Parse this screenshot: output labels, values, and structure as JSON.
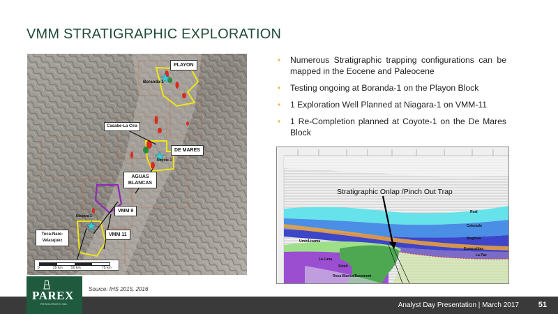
{
  "title": "VMM STRATIGRAPHIC EXPLORATION",
  "map": {
    "labels": {
      "playon": "PLAYON",
      "boranda": "Boranda-1",
      "casabe": "Casabe-La Cira",
      "de_mares": "DE MARES",
      "coyote": "Coyote-1",
      "aguas_blancas": "AGUAS BLANCAS",
      "vmm9": "VMM 9",
      "niagara": "Niagara-1",
      "vmm11": "VMM 11",
      "teca": "Teca-Nare-Velasquez",
      "scale_0": "0",
      "scale_1": "25 km",
      "scale_2": "50 km",
      "scale_3": "75 km"
    }
  },
  "bullets": [
    "Numerous Stratigraphic trapping configurations can be mapped in the Eocene and Paleocene",
    "Testing ongoing at Boranda-1 on the Playon Block",
    "1 Exploration Well Planned at Niagara-1 on VMM-11",
    "1 Re-Completion planned at Coyote-1 on the De Mares Block"
  ],
  "bullet_symbol": "•",
  "seismic": {
    "caption": "Stratigraphic Onlap /Pinch Out Trap",
    "layers": {
      "real": "Real",
      "colorado": "Colorado",
      "mugrosa": "Mugrosa",
      "esmeraldas": "Esmeraldas",
      "la_paz": "La Paz",
      "umir": "Umir/Lisama",
      "la_luna": "La Luna",
      "simiti": "Simiti",
      "rosa_blanca": "Rosa Blanca/Basement"
    }
  },
  "source": "Source: IHS 2015, 2016",
  "footer": {
    "text": "Analyst Day Presentation |  March 2017",
    "page": "51"
  },
  "logo": {
    "name": "PAREX",
    "sub": "RESOURCES INC"
  },
  "colors": {
    "title": "#1f4b37",
    "bullet": "#f1b63b",
    "footer": "#3a3a3a",
    "logo": "#1f5a3e"
  }
}
